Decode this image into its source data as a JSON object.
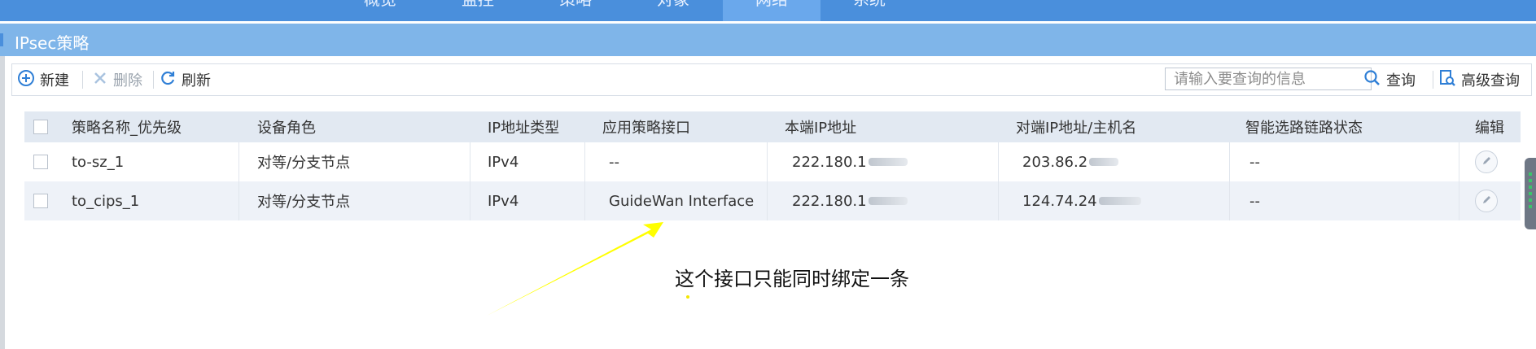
{
  "nav": {
    "tabs": [
      "概览",
      "监控",
      "策略",
      "对象",
      "网络",
      "系统"
    ],
    "active_index": 4
  },
  "page_title": "IPsec策略",
  "toolbar": {
    "new_label": "新建",
    "delete_label": "删除",
    "refresh_label": "刷新",
    "search_placeholder": "请输入要查询的信息",
    "query_label": "查询",
    "advanced_query_label": "高级查询"
  },
  "table": {
    "headers": [
      "策略名称_优先级",
      "设备角色",
      "IP地址类型",
      "应用策略接口",
      "本端IP地址",
      "对端IP地址/主机名",
      "智能选路链路状态",
      "编辑"
    ],
    "rows": [
      {
        "name": "to-sz_1",
        "role": "对等/分支节点",
        "ip_type": "IPv4",
        "interface": "--",
        "local_ip": "222.180.1",
        "peer_ip": "203.86.2",
        "link_status": "--"
      },
      {
        "name": "to_cips_1",
        "role": "对等/分支节点",
        "ip_type": "IPv4",
        "interface": "GuideWan Interface",
        "local_ip": "222.180.1",
        "peer_ip": "124.74.24",
        "link_status": "--"
      }
    ]
  },
  "annotation": {
    "text": "这个接口只能同时绑定一条",
    "arrow_color": "#ffff00"
  },
  "colors": {
    "nav_bg": "#4a8fdc",
    "title_bg": "#7fb5e9",
    "header_bg": "#e2e9f2",
    "icon_blue": "#2f7fd6"
  }
}
